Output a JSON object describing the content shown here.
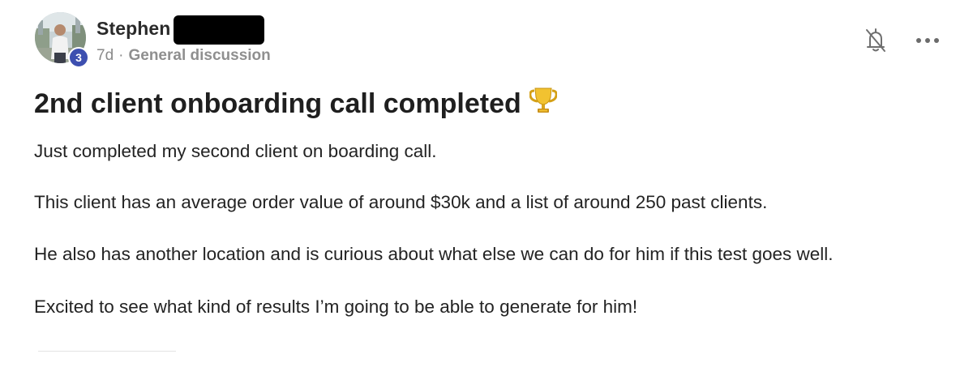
{
  "author": {
    "name": "Stephen",
    "level": "3"
  },
  "meta": {
    "time": "7d",
    "separator": "·",
    "category": "General discussion"
  },
  "post": {
    "title": "2nd client onboarding call completed",
    "paragraphs": [
      "Just completed my second client on boarding call.",
      "This client has an average order value of around $30k and a list of around 250 past clients.",
      "He also has another location and is curious about what else we can do for him if this test goes well.",
      "Excited to see what kind of results I’m going to be able to generate for him!"
    ]
  },
  "icons": {
    "bell": "bell-off-icon",
    "more": "more-horizontal-icon",
    "trophy": "trophy-icon"
  },
  "colors": {
    "level_badge": "#3d4fb0",
    "meta_text": "#8a8a8a",
    "title_text": "#1f1f1f"
  }
}
